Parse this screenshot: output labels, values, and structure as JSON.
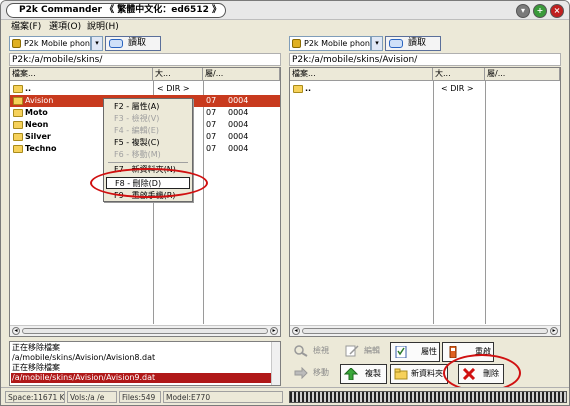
{
  "window": {
    "title": "P2k Commander 《 繁體中文化：ed6512 》",
    "controls": [
      "minimize-icon",
      "maximize-icon",
      "close-icon"
    ],
    "accent_color": "#d01010"
  },
  "menu": {
    "items": [
      {
        "label": "檔案(F)"
      },
      {
        "label": "選項(O)"
      },
      {
        "label": "說明(H)"
      }
    ]
  },
  "left_panel": {
    "device": "P2k Mobile phone",
    "read_label": "讀取",
    "path": "P2k:/a/mobile/skins/",
    "headers": {
      "name": "檔案...",
      "size": "大...",
      "attr": "屬/..."
    },
    "rows": [
      {
        "name": "..",
        "size": "< DIR >",
        "c1": "",
        "c2": ""
      },
      {
        "name": "Avision",
        "size": "",
        "c1": "07",
        "c2": "0004"
      },
      {
        "name": "Moto",
        "size": "",
        "c1": "07",
        "c2": "0004"
      },
      {
        "name": "Neon",
        "size": "",
        "c1": "07",
        "c2": "0004"
      },
      {
        "name": "Silver",
        "size": "",
        "c1": "07",
        "c2": "0004"
      },
      {
        "name": "Techno",
        "size": "",
        "c1": "07",
        "c2": "0004"
      }
    ]
  },
  "right_panel": {
    "device": "P2k Mobile phone",
    "read_label": "讀取",
    "path": "P2k:/a/mobile/skins/Avision/",
    "headers": {
      "name": "檔案...",
      "size": "大...",
      "attr": "屬/..."
    },
    "rows": [
      {
        "name": "..",
        "size": "< DIR >"
      }
    ]
  },
  "context_menu": {
    "items": [
      {
        "label": "F2 - 屬性(A)",
        "disabled": false
      },
      {
        "label": "F3 - 檢視(V)",
        "disabled": true
      },
      {
        "label": "F4 - 編輯(E)",
        "disabled": true
      },
      {
        "label": "F5 - 複製(C)",
        "disabled": false
      },
      {
        "label": "F6 - 移動(M)",
        "disabled": true
      },
      {
        "label": "F7 - 新資料夾(N)",
        "disabled": false
      },
      {
        "label": "F8 - 刪除(D)",
        "disabled": false,
        "selected": true
      },
      {
        "label": "F9 - 重啟手機(R)",
        "disabled": false
      }
    ]
  },
  "log": {
    "lines": [
      "正在移除檔案",
      "/a/mobile/skins/Avision/Avision8.dat",
      "正在移除檔案",
      "/a/mobile/skins/Avision/Avision9.dat"
    ]
  },
  "toolbar": {
    "view": "檢視",
    "edit": "編輯",
    "properties": "屬性",
    "restart": "重啟",
    "move": "移動",
    "copy": "複製",
    "new_folder": "新資料夾",
    "delete": "刪除"
  },
  "status": {
    "space": "Space:11671 K",
    "vols": "Vols:/a /e",
    "files": "Files:549",
    "model": "Model:E770"
  }
}
